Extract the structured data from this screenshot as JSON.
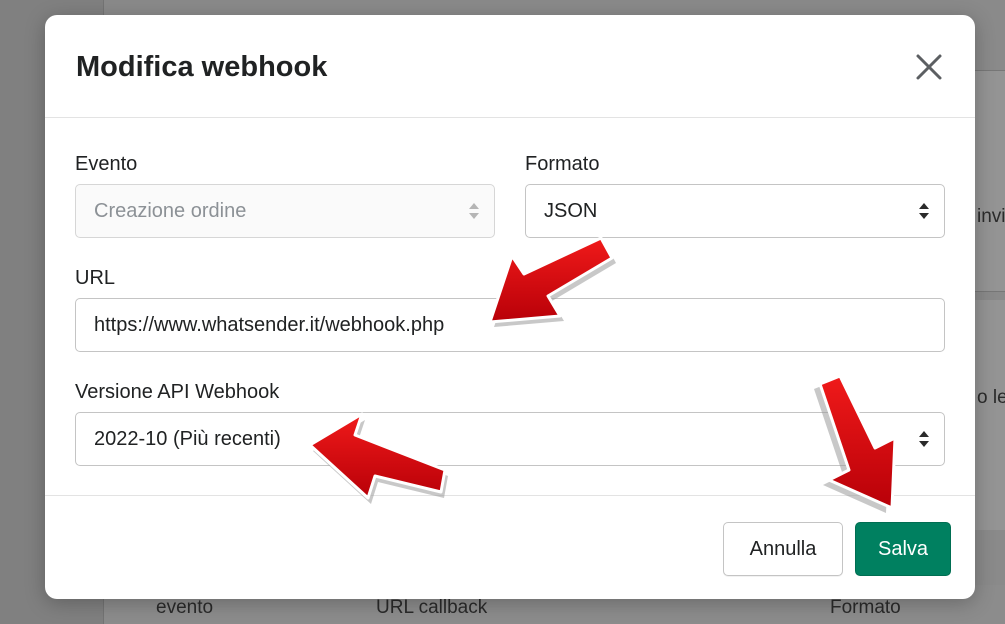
{
  "background": {
    "text_right_1": "invi",
    "text_right_2": "o le",
    "footer_col_event": "evento",
    "footer_col_url": "URL callback",
    "footer_col_format": "Formato"
  },
  "modal": {
    "title": "Modifica webhook",
    "close_icon": "close-icon",
    "event": {
      "label": "Evento",
      "value": "Creazione ordine"
    },
    "format": {
      "label": "Formato",
      "value": "JSON"
    },
    "url": {
      "label": "URL",
      "value": "https://www.whatsender.it/webhook.php"
    },
    "api_version": {
      "label": "Versione API Webhook",
      "value": "2022-10 (Più recenti)"
    },
    "cancel_label": "Annulla",
    "save_label": "Salva"
  },
  "colors": {
    "primary": "#008060",
    "annotation": "#d9000b"
  }
}
